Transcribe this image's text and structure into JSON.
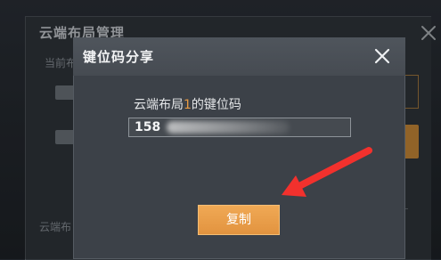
{
  "background": {
    "title": "云端布局管理",
    "subtext_top": "当前布局",
    "subtext_bottom": "云端布"
  },
  "dialog": {
    "title": "键位码分享",
    "label_prefix": "云端布局",
    "label_accent": "1",
    "label_suffix": "的键位码",
    "code_value_visible": "158",
    "copy_button": "复制"
  },
  "icons": {
    "dialog_close": "close-icon",
    "background_close": "close-icon",
    "pointer_arrow": "arrow-icon",
    "paw": "paw-icon"
  },
  "colors": {
    "accent": "#e79a43",
    "button": "#e2933f",
    "dialog_bg": "#3c4148",
    "header_bg": "#4f555c",
    "arrow": "#f2312d"
  }
}
